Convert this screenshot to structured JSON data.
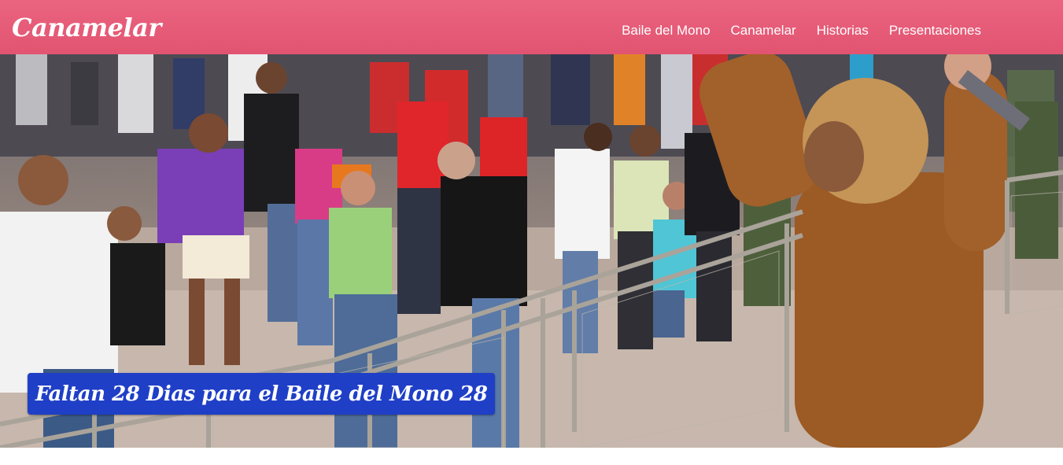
{
  "navbar": {
    "brand": "Canamelar",
    "links": [
      {
        "label": "Baile del Mono"
      },
      {
        "label": "Canamelar"
      },
      {
        "label": "Historias"
      },
      {
        "label": "Presentaciones"
      }
    ]
  },
  "hero": {
    "banner_text": "Faltan 28 Dias para el Baile del Mono 28"
  },
  "colors": {
    "navbar": "#e65a77",
    "banner": "#1f3fc7"
  }
}
